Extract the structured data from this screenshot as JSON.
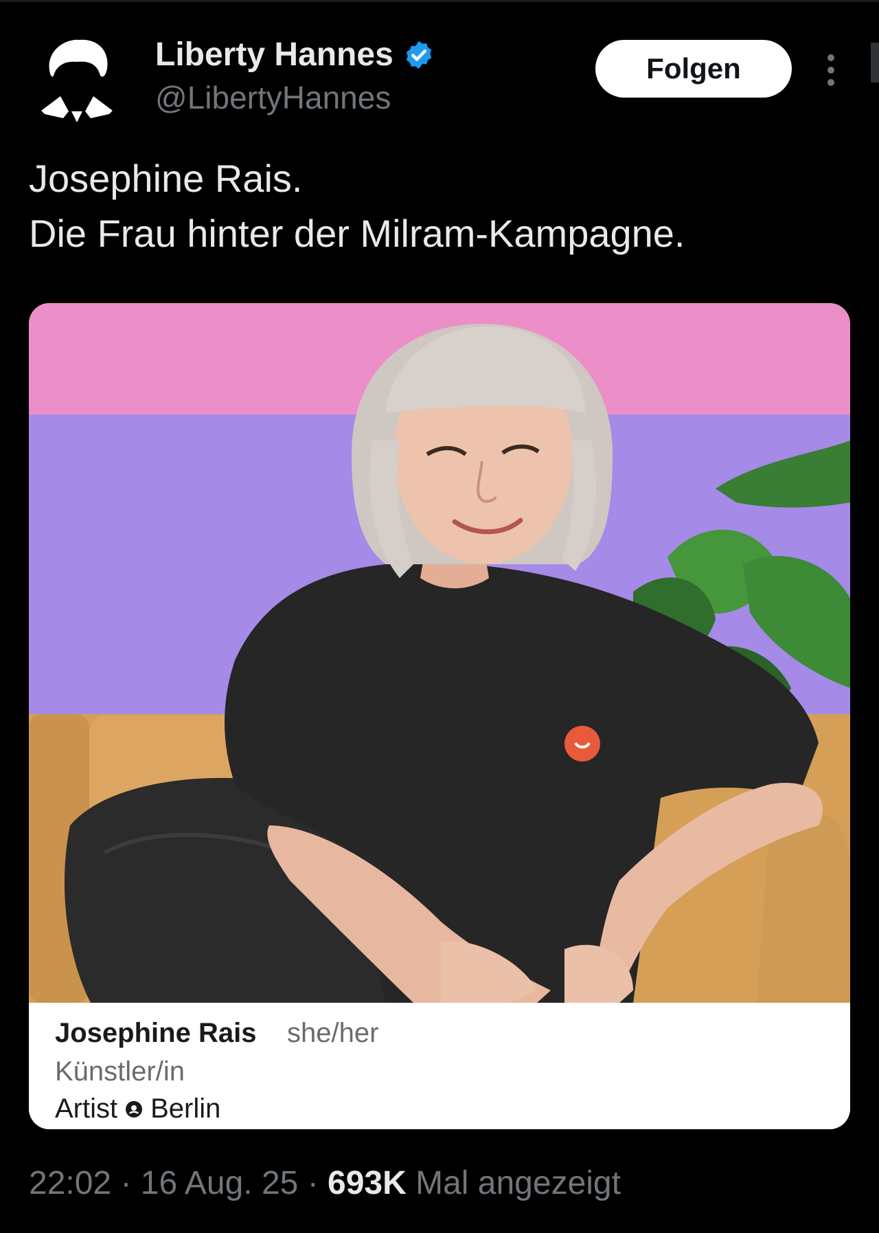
{
  "tweet": {
    "author": {
      "display_name": "Liberty Hannes",
      "handle": "@LibertyHannes",
      "verified": true,
      "verified_icon": "verified-badge-icon",
      "avatar_icon": "silhouette-avatar"
    },
    "follow_label": "Folgen",
    "more_icon": "more-vertical-icon",
    "text_lines": [
      "Josephine Rais.",
      "Die Frau hinter der Milram-Kampagne."
    ],
    "media": {
      "caption": {
        "name": "Josephine Rais",
        "pronouns": "she/her",
        "title": "Künstler/in",
        "location_prefix": "Artist",
        "location": "Berlin"
      }
    },
    "time": "22:02",
    "date": "16 Aug. 25",
    "views_count": "693K",
    "views_label": "Mal angezeigt",
    "separator": "·"
  },
  "colors": {
    "background": "#000000",
    "primary_text": "#e7e9ea",
    "secondary_text": "#71767b",
    "verified_blue": "#1d9bf0",
    "follow_button_bg": "#ffffff"
  }
}
